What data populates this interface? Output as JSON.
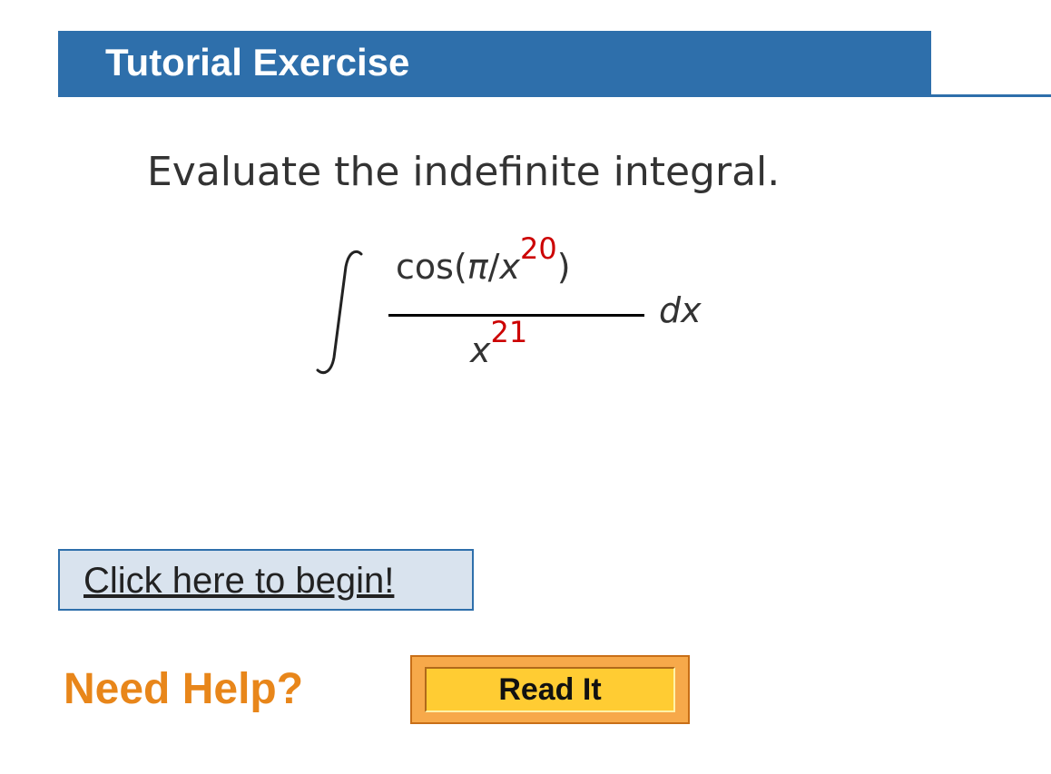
{
  "header": {
    "title": "Tutorial Exercise"
  },
  "problem": {
    "prompt": "Evaluate the indefinite integral.",
    "integral": {
      "numerator_func": "cos(",
      "numerator_pi": "π",
      "numerator_slash": "/",
      "numerator_var": "x",
      "numerator_exponent": "20",
      "numerator_close": ")",
      "denominator_var": "x",
      "denominator_exponent": "21",
      "differential": "dx"
    }
  },
  "actions": {
    "begin_label": "Click here to begin!",
    "need_help_label": "Need Help?",
    "read_it_label": "Read It"
  },
  "colors": {
    "header_bg": "#2e6fab",
    "exponent": "#cc0000",
    "need_help": "#e8861a",
    "read_it_bg": "#ffcc33"
  }
}
